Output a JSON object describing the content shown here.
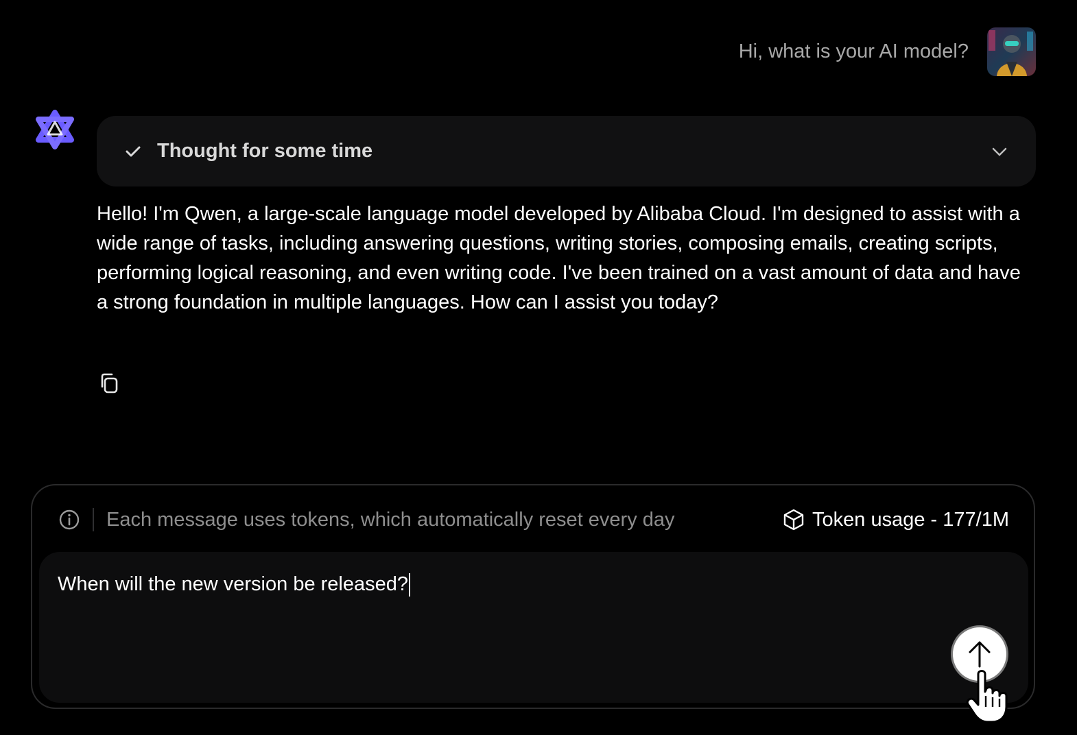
{
  "user_message": {
    "text": "Hi, what is your AI model?",
    "avatar": "user-avatar"
  },
  "assistant": {
    "logo": "qwen-logo-icon",
    "thought": {
      "label": "Thought for some time",
      "status_icon": "check-icon",
      "toggle_icon": "chevron-down-icon"
    },
    "answer": "Hello! I'm Qwen, a large-scale language model developed by Alibaba Cloud. I'm designed to assist with a wide range of tasks, including answering questions, writing stories, composing emails, creating scripts, performing logical reasoning, and even writing code. I've been trained on a vast amount of data and have a strong foundation in multiple languages. How can I assist you today?",
    "copy_icon": "copy-icon"
  },
  "composer": {
    "info_text": "Each message uses tokens, which automatically reset every day",
    "token_usage": "Token usage - 177/1M",
    "input_value": "When will the new version be released?",
    "send_icon": "arrow-up-icon"
  },
  "colors": {
    "background": "#000000",
    "panel": "#111112",
    "accent_logo": "#6a5cff"
  }
}
